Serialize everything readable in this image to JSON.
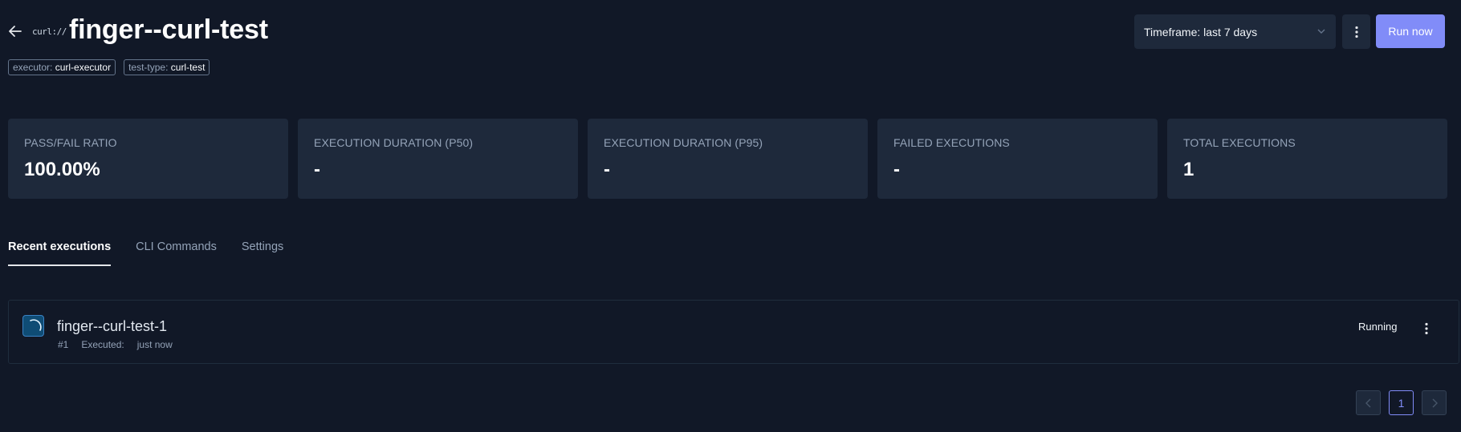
{
  "header": {
    "title": "finger--curl-test",
    "executor_logo_text": "curl://",
    "labels": [
      {
        "key": "executor:",
        "value": "curl-executor"
      },
      {
        "key": "test-type:",
        "value": "curl-test"
      }
    ],
    "timeframe_label": "Timeframe: last 7 days",
    "run_button_label": "Run now"
  },
  "metrics": [
    {
      "title": "PASS/FAIL RATIO",
      "value": "100.00%"
    },
    {
      "title": "EXECUTION DURATION (P50)",
      "value": "-"
    },
    {
      "title": "EXECUTION DURATION (P95)",
      "value": "-"
    },
    {
      "title": "FAILED EXECUTIONS",
      "value": "-"
    },
    {
      "title": "TOTAL EXECUTIONS",
      "value": "1"
    }
  ],
  "tabs": [
    {
      "label": "Recent executions",
      "active": true
    },
    {
      "label": "CLI Commands",
      "active": false
    },
    {
      "label": "Settings",
      "active": false
    }
  ],
  "executions": [
    {
      "name": "finger--curl-test-1",
      "number": "#1",
      "executed_label": "Executed:",
      "executed_value": "just now",
      "status": "Running",
      "status_icon": "running-spinner-icon"
    }
  ],
  "pagination": {
    "current_page": "1"
  },
  "colors": {
    "background": "#111827",
    "card": "#1e293b",
    "accent": "#818cf8",
    "running_blue": "#0f4c75"
  }
}
